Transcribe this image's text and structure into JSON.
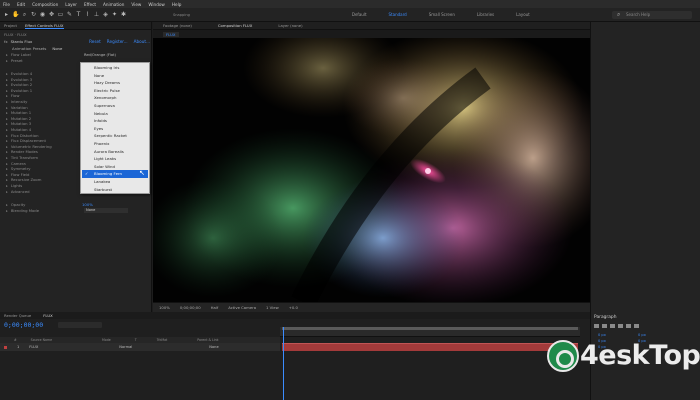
{
  "menu": [
    "File",
    "Edit",
    "Composition",
    "Layer",
    "Effect",
    "Animation",
    "View",
    "Window",
    "Help"
  ],
  "toolbar": {
    "tools": [
      "arrow-icon",
      "hand-icon",
      "zoom-icon",
      "rotate-icon",
      "camera-icon",
      "pan-icon",
      "rect-icon",
      "pen-icon",
      "type-icon",
      "brush-icon",
      "stamp-icon",
      "eraser-icon",
      "roto-icon",
      "puppet-icon"
    ],
    "snapping_label": "Snapping",
    "workspaces": [
      {
        "label": "Default",
        "active": false
      },
      {
        "label": "Standard",
        "active": true
      },
      {
        "label": "Small Screen",
        "active": false
      },
      {
        "label": "Libraries",
        "active": false
      },
      {
        "label": "Layout",
        "active": false
      }
    ],
    "search_placeholder": "Search Help"
  },
  "left_panel": {
    "tabs": [
      {
        "label": "Project",
        "active": false
      },
      {
        "label": "Effect Controls FLUX",
        "active": true
      }
    ],
    "breadcrumb": "FLUX · FLUX",
    "effect_name": "Stardu Flux",
    "effect_links": [
      "Reset",
      "Register...",
      "About..."
    ],
    "animation_presets_label": "Animation Presets",
    "animation_presets_value": "None",
    "sub_value": "Red/Orange (Flat)",
    "props": [
      "Flow Label",
      "Preset",
      "Evolution 4",
      "Evolution 3",
      "Evolution 2",
      "Evolution 1",
      "Flow",
      "Intensity",
      "Variation",
      "Mutation 1",
      "Mutation 2",
      "Mutation 3",
      "Mutation 4",
      "Flux Distortion",
      "Flux Displacement",
      "Volumetric Rendering",
      "Render Modes",
      "Tint Transform",
      "Camera",
      "Symmetry",
      "Flow Field",
      "Recursive Zoom",
      "Lights",
      "Advanced",
      "Opacity",
      "Blending Mode"
    ],
    "opacity_value": "100%",
    "blending_value": "None"
  },
  "dropdown": {
    "items": [
      {
        "label": "Blooming Iris",
        "selected": false
      },
      {
        "label": "None",
        "selected": false
      },
      {
        "label": "Hazy Dreams",
        "selected": false
      },
      {
        "label": "Electric Pulse",
        "selected": false
      },
      {
        "label": "Xenomorph",
        "selected": false
      },
      {
        "label": "Supernova",
        "selected": false
      },
      {
        "label": "Nebula",
        "selected": false
      },
      {
        "label": "Infolds",
        "selected": false
      },
      {
        "label": "Eyes",
        "selected": false
      },
      {
        "label": "Serpentic Racket",
        "selected": false
      },
      {
        "label": "Phoenix",
        "selected": false
      },
      {
        "label": "Aurora Borealis",
        "selected": false
      },
      {
        "label": "Light Leaks",
        "selected": false
      },
      {
        "label": "Solar Wind",
        "selected": false
      },
      {
        "label": "Blooming Fern",
        "selected": true
      },
      {
        "label": "Lanakea",
        "selected": false
      },
      {
        "label": "Starburst",
        "selected": false
      }
    ]
  },
  "viewer": {
    "tabs": [
      {
        "label": "Footage (none)",
        "active": false
      },
      {
        "label": "Composition FLUX",
        "active": true
      },
      {
        "label": "Layer (none)",
        "active": false
      }
    ],
    "sub_tab": "FLUX",
    "bar": [
      "100%",
      "0;00;00;00",
      "Half",
      "Active Camera",
      "1 View",
      "+0.0"
    ]
  },
  "timeline": {
    "tabs": [
      {
        "label": "Render Queue",
        "active": false
      },
      {
        "label": "FLUX",
        "active": true
      }
    ],
    "timecode": "0;00;00;00",
    "ruler_ticks": [
      "0s",
      "02s",
      "04s",
      "06s",
      "08s",
      "10s",
      "12s",
      "14s",
      "16s",
      "18s",
      "20s",
      "22s",
      "24s"
    ],
    "layer_columns": [
      "#",
      "Source Name",
      "Mode",
      "T",
      "TrkMat",
      "Parent & Link"
    ],
    "layer_row": {
      "index": "1",
      "name": "FLUX",
      "mode": "Normal",
      "parent": "None"
    }
  },
  "paragraph": {
    "title": "Paragraph",
    "values": [
      "0 px",
      "0 px",
      "0 px",
      "0 px",
      "0 px"
    ]
  },
  "watermark": {
    "text": "4eskTop"
  },
  "colors": {
    "accent": "#3b8cff",
    "layer_bar": "#a33a3a",
    "watermark": "#1f8a4a"
  }
}
